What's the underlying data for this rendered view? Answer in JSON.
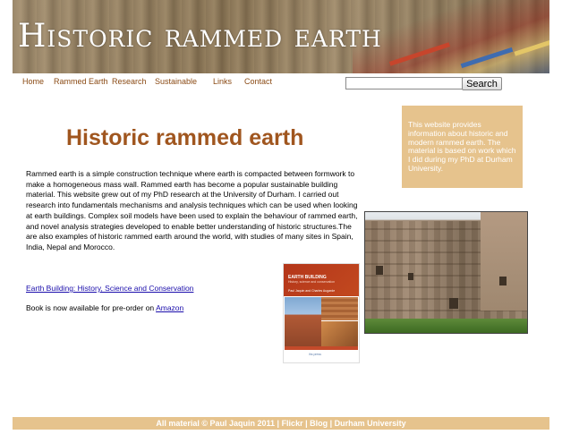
{
  "banner": {
    "title": "Historic rammed earth"
  },
  "nav": {
    "items": [
      {
        "label": "Home"
      },
      {
        "label": "Rammed Earth"
      },
      {
        "label": "Research"
      },
      {
        "label": "Sustainable"
      },
      {
        "label": "Links"
      },
      {
        "label": "Contact"
      }
    ]
  },
  "search": {
    "value": "",
    "button_label": "Search"
  },
  "sidebar": {
    "info_text": "This website provides information about historic and modern rammed earth. The material is based on work which I did during my PhD at Durham University."
  },
  "main": {
    "heading": "Historic rammed earth",
    "intro": "Rammed earth is a simple construction technique where earth is compacted between formwork to make a homogeneous mass wall. Rammed earth has become a popular sustainable building material. This website grew out of my PhD research at the University of Durham. I carried out research into fundamentals mechanisms and analysis techniques which can be used when looking at earth buildings. Complex soil models have been used to explain the behaviour of rammed earth, and novel analysis strategies developed to enable better understanding of historic structures.The are also examples of historic rammed earth around the world, with studies of many sites in Spain, India, Nepal and Morocco.",
    "book_link": "Earth Building: History, Science and Conservation",
    "preorder_text": "Book is now available for pre-order on ",
    "amazon_link": "Amazon"
  },
  "book_cover": {
    "title": "EARTH BUILDING",
    "subtitle": "History, science and conservation",
    "authors": "Paul Jaquin and Charles Augarde",
    "publisher": "ihs press"
  },
  "footer": {
    "copyright": "All material © Paul Jaquin 2011",
    "sep": " | ",
    "links": [
      "Flickr",
      "Blog",
      "Durham University"
    ]
  },
  "colors": {
    "accent": "#a0561f",
    "nav_text": "#8a4a14",
    "box_bg": "#e6c38d",
    "link": "#1a0dab"
  }
}
